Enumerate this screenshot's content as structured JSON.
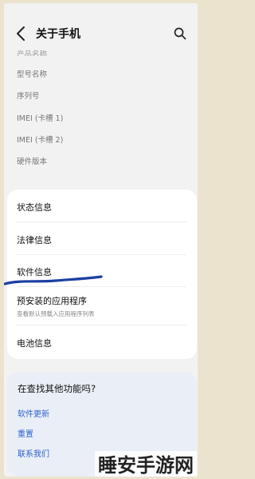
{
  "header": {
    "title": "关于手机"
  },
  "info_items": [
    {
      "label": "产品名称"
    },
    {
      "label": "型号名称"
    },
    {
      "label": "序列号"
    },
    {
      "label": "IMEI (卡槽 1)"
    },
    {
      "label": "IMEI (卡槽 2)"
    },
    {
      "label": "硬件版本"
    }
  ],
  "menu": [
    {
      "label": "状态信息"
    },
    {
      "label": "法律信息"
    },
    {
      "label": "软件信息"
    },
    {
      "label": "预安装的应用程序",
      "subtitle": "查看默认预载入应用程序列表"
    },
    {
      "label": "电池信息"
    }
  ],
  "suggestions": {
    "title": "在查找其他功能吗?",
    "links": [
      "软件更新",
      "重置",
      "联系我们"
    ]
  },
  "watermark": {
    "text": "睡安手游网"
  },
  "colors": {
    "link": "#2e62c8",
    "annotation": "#1c3fa0"
  }
}
